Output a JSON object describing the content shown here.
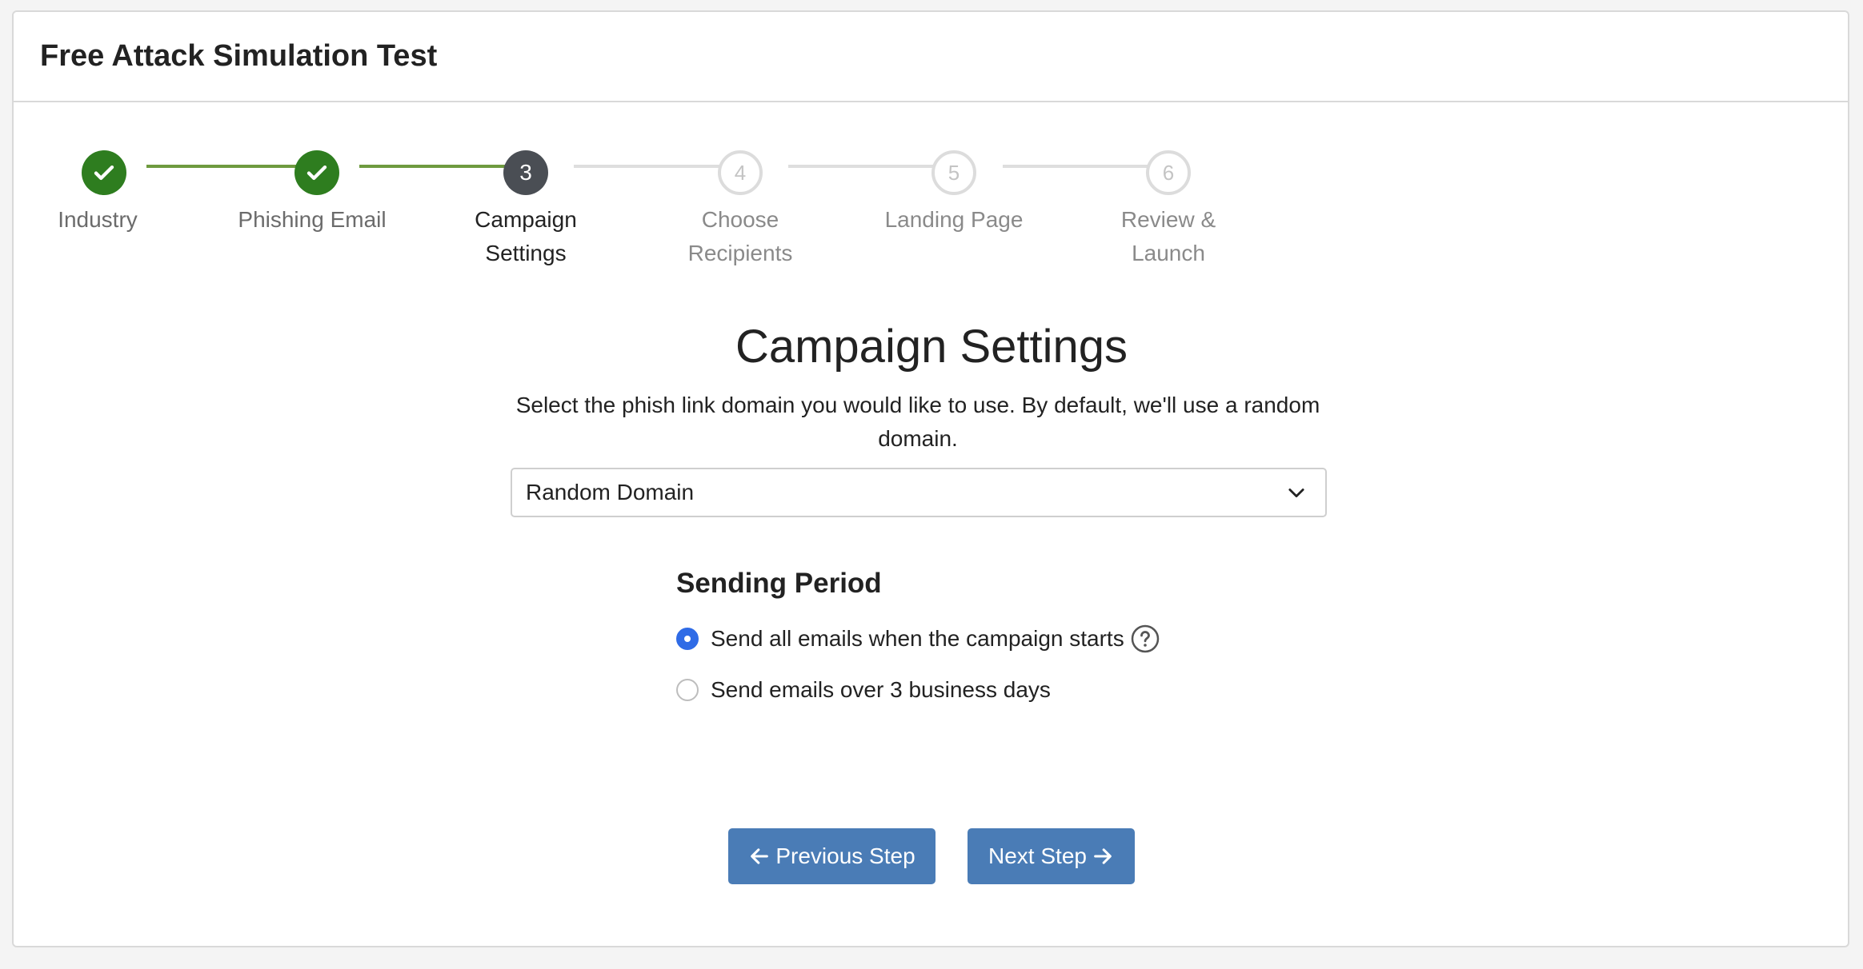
{
  "page": {
    "title": "Free Attack Simulation Test"
  },
  "stepper": {
    "steps": [
      {
        "number": "1",
        "label": "Industry",
        "state": "done"
      },
      {
        "number": "2",
        "label": "Phishing Email",
        "state": "done"
      },
      {
        "number": "3",
        "label": "Campaign Settings",
        "state": "active"
      },
      {
        "number": "4",
        "label": "Choose Recipients",
        "state": "pending"
      },
      {
        "number": "5",
        "label": "Landing Page",
        "state": "pending"
      },
      {
        "number": "6",
        "label": "Review & Launch",
        "state": "pending"
      }
    ]
  },
  "main": {
    "title": "Campaign Settings",
    "description": "Select the phish link domain you would like to use. By default, we'll use a random domain.",
    "domain_select": {
      "value": "Random Domain"
    }
  },
  "sending_period": {
    "title": "Sending Period",
    "options": [
      {
        "label": "Send all emails when the campaign starts",
        "checked": true
      },
      {
        "label": "Send emails over 3 business days",
        "checked": false
      }
    ]
  },
  "buttons": {
    "previous": "Previous Step",
    "next": "Next Step"
  },
  "colors": {
    "done": "#2e7d1f",
    "done_connector": "#6e9a3f",
    "active": "#4a4e54",
    "pending_border": "#dcdcdc",
    "radio_checked": "#2f6be6",
    "button": "#4a7cb6"
  },
  "icons": {
    "check": "check-icon",
    "chevron": "chevron-down-icon",
    "help": "question-circle-icon",
    "prev": "arrow-left-icon",
    "next": "arrow-right-icon"
  }
}
